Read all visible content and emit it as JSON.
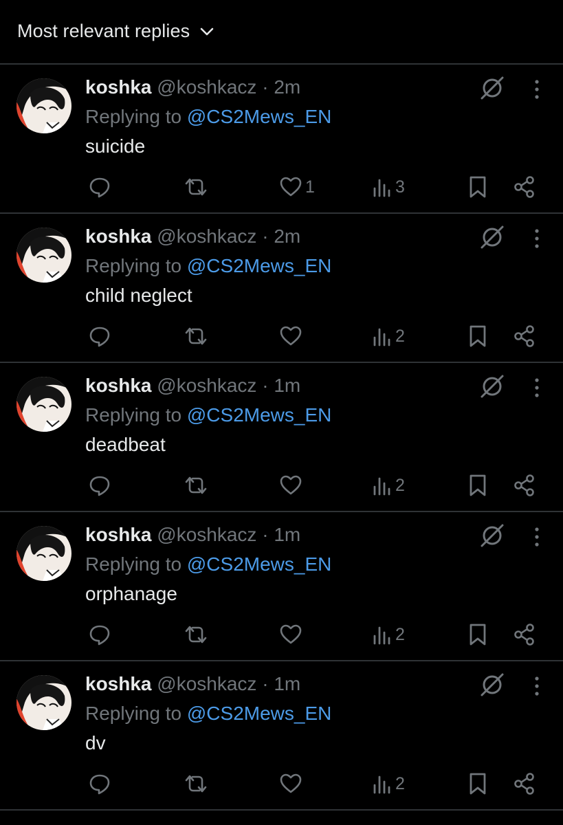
{
  "header": {
    "label": "Most relevant replies",
    "dropdown_icon": "chevron-down-icon"
  },
  "replies": [
    {
      "name": "koshka",
      "handle": "@koshkacz",
      "separator": "·",
      "time": "2m",
      "replying_prefix": "Replying to ",
      "replying_to": "@CS2Mews_EN",
      "text": "suicide",
      "likes": "1",
      "views": "3"
    },
    {
      "name": "koshka",
      "handle": "@koshkacz",
      "separator": "·",
      "time": "2m",
      "replying_prefix": "Replying to ",
      "replying_to": "@CS2Mews_EN",
      "text": "child neglect",
      "likes": "",
      "views": "2"
    },
    {
      "name": "koshka",
      "handle": "@koshkacz",
      "separator": "·",
      "time": "1m",
      "replying_prefix": "Replying to ",
      "replying_to": "@CS2Mews_EN",
      "text": "deadbeat",
      "likes": "",
      "views": "2"
    },
    {
      "name": "koshka",
      "handle": "@koshkacz",
      "separator": "·",
      "time": "1m",
      "replying_prefix": "Replying to ",
      "replying_to": "@CS2Mews_EN",
      "text": "orphanage",
      "likes": "",
      "views": "2"
    },
    {
      "name": "koshka",
      "handle": "@koshkacz",
      "separator": "·",
      "time": "1m",
      "replying_prefix": "Replying to ",
      "replying_to": "@CS2Mews_EN",
      "text": "dv",
      "likes": "",
      "views": "2"
    }
  ],
  "icons": {
    "reply": "reply-icon",
    "retweet": "retweet-icon",
    "like": "heart-icon",
    "views": "views-icon",
    "bookmark": "bookmark-icon",
    "share": "share-icon",
    "grok": "grok-icon",
    "more": "more-icon"
  },
  "colors": {
    "background": "#000000",
    "divider": "#2f3336",
    "text_primary": "#e7e9ea",
    "text_secondary": "#71767b",
    "link": "#4c9be8",
    "avatar_accent": "#e0442e"
  }
}
